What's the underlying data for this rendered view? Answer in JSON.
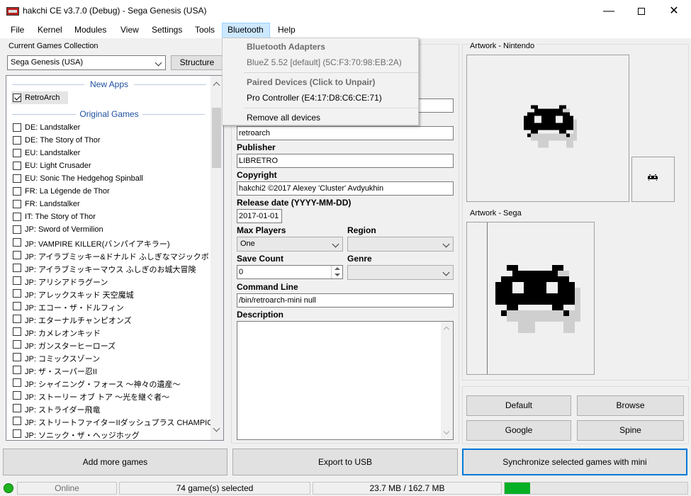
{
  "window": {
    "title": "hakchi CE v3.7.0 (Debug) - Sega Genesis (USA)"
  },
  "menubar": {
    "items": [
      "File",
      "Kernel",
      "Modules",
      "View",
      "Settings",
      "Tools",
      "Bluetooth",
      "Help"
    ]
  },
  "left": {
    "collection_label": "Current Games Collection",
    "collection_value": "Sega Genesis (USA)",
    "structure_button": "Structure",
    "new_apps_header": "New Apps",
    "original_games_header": "Original Games",
    "new_apps": [
      {
        "name": "RetroArch",
        "checked": true
      }
    ],
    "games": [
      "DE: Landstalker",
      "DE: The Story of Thor",
      "EU: Landstalker",
      "EU: Light Crusader",
      "EU: Sonic The Hedgehog Spinball",
      "FR: La Légende de Thor",
      "FR: Landstalker",
      "IT: The Story of Thor",
      "JP: Sword of Vermilion",
      "JP: VAMPIRE KILLER(バンパイアキラー)",
      "JP: アイラブミッキー&ドナルド ふしぎなマジックボッ…",
      "JP: アイラブミッキーマウス ふしぎのお城大冒険",
      "JP: アリシアドラグーン",
      "JP: アレックスキッド 天空魔城",
      "JP: エコー・ザ・ドルフィン",
      "JP: エターナルチャンピオンズ",
      "JP: カメレオンキッド",
      "JP: ガンスターヒーローズ",
      "JP: コミックスゾーン",
      "JP: ザ・スーパー忍II",
      "JP: シャイニング・フォース 〜神々の遺産〜",
      "JP: ストーリー オブ トア 〜光を継ぐ者〜",
      "JP: ストライダー飛竜",
      "JP: ストリートファイターIIダッシュプラス CHAMPION E…",
      "JP: ソニック・ザ・ヘッジホッグ"
    ]
  },
  "details": {
    "name_value": "retroarch",
    "publisher_label": "Publisher",
    "publisher_value": "LIBRETRO",
    "copyright_label": "Copyright",
    "copyright_value": "hakchi2 ©2017 Alexey 'Cluster' Avdyukhin",
    "release_label": "Release date (YYYY-MM-DD)",
    "release_value": "2017-01-01",
    "max_players_label": "Max Players",
    "max_players_value": "One",
    "region_label": "Region",
    "region_value": "",
    "save_count_label": "Save Count",
    "save_count_value": "0",
    "genre_label": "Genre",
    "genre_value": "",
    "command_line_label": "Command Line",
    "command_line_value": "/bin/retroarch-mini null",
    "description_label": "Description",
    "description_value": ""
  },
  "bluetooth_menu": {
    "adapters_header": "Bluetooth Adapters",
    "adapter": "BlueZ 5.52 [default] (5C:F3:70:98:EB:2A)",
    "paired_header": "Paired Devices (Click to Unpair)",
    "paired_device": "Pro Controller (E4:17:D8:C6:CE:71)",
    "remove_all": "Remove all devices"
  },
  "artwork": {
    "nintendo_label": "Artwork - Nintendo",
    "sega_label": "Artwork - Sega",
    "buttons": {
      "default": "Default",
      "browse": "Browse",
      "google": "Google",
      "spine": "Spine"
    }
  },
  "actions": {
    "add_more_games": "Add more games",
    "export_usb": "Export to USB",
    "synchronize": "Synchronize selected games with mini"
  },
  "status": {
    "online": "Online",
    "games_selected": "74 game(s) selected",
    "storage": "23.7 MB / 162.7 MB",
    "progress_fraction": 0.14,
    "online_color": "#1db31d",
    "progress_color": "#06b025"
  }
}
